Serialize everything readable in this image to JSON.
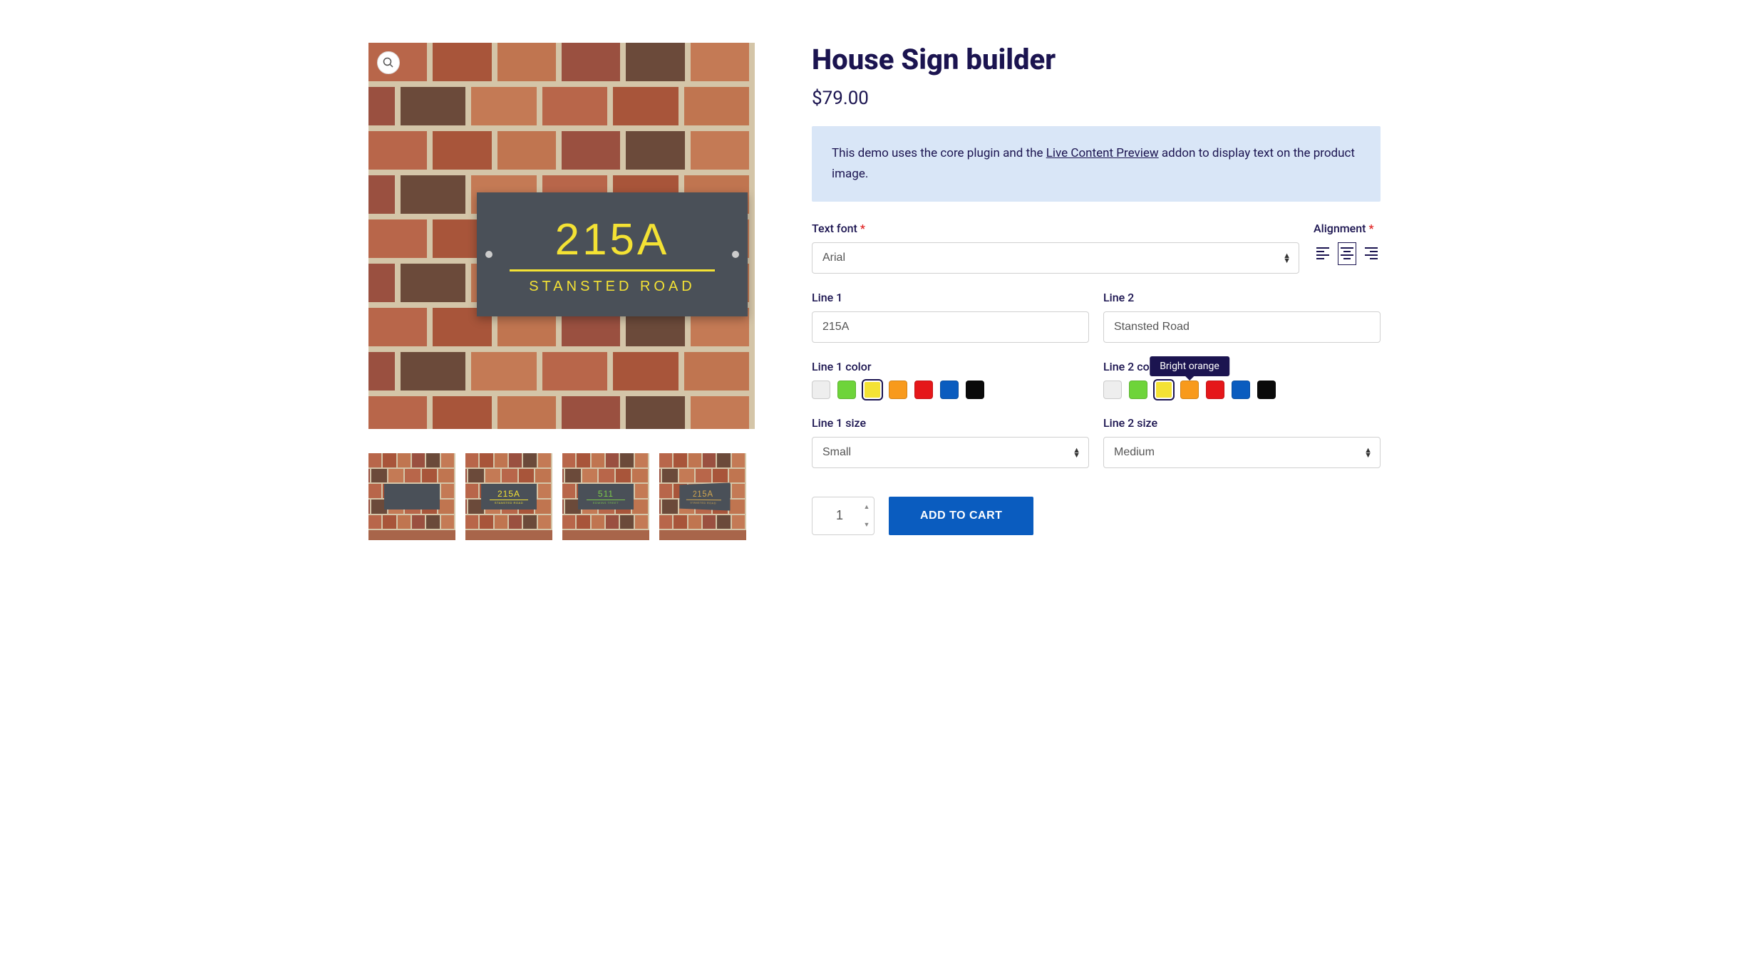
{
  "product": {
    "title": "House Sign builder",
    "price": "$79.00"
  },
  "notice": {
    "pre": "This demo uses the core plugin and the ",
    "link": "Live Content Preview",
    "post": " addon to display text on the product image."
  },
  "preview": {
    "line1": "215A",
    "line2": "STANSTED ROAD"
  },
  "thumbnails": [
    {
      "line1": "",
      "line2": "",
      "color": "#888"
    },
    {
      "line1": "215A",
      "line2": "STANSTED ROAD",
      "color": "#f4e234"
    },
    {
      "line1": "511",
      "line2": "EDWINS TREET",
      "color": "#7cc94a"
    },
    {
      "line1": "215A",
      "line2": "STANSTED ROAD",
      "color": "#d4a850"
    }
  ],
  "fields": {
    "font": {
      "label": "Text font",
      "value": "Arial"
    },
    "alignment": {
      "label": "Alignment",
      "value": "center"
    },
    "line1": {
      "label": "Line 1",
      "value": "215A"
    },
    "line2": {
      "label": "Line 2",
      "value": "Stansted Road"
    },
    "line1color": {
      "label": "Line 1 color",
      "selected": 2
    },
    "line2color": {
      "label": "Line 2 color",
      "selected": 2
    },
    "line1size": {
      "label": "Line 1 size",
      "value": "Small"
    },
    "line2size": {
      "label": "Line 2 size",
      "value": "Medium"
    }
  },
  "colors": [
    {
      "name": "White",
      "hex": "#eeeeee"
    },
    {
      "name": "Green",
      "hex": "#6ed43a"
    },
    {
      "name": "Yellow",
      "hex": "#f4e234"
    },
    {
      "name": "Bright orange",
      "hex": "#f89a1c"
    },
    {
      "name": "Red",
      "hex": "#e5171a"
    },
    {
      "name": "Blue",
      "hex": "#0a5cbf"
    },
    {
      "name": "Black",
      "hex": "#0a0a0a"
    }
  ],
  "tooltip": {
    "text": "Bright orange",
    "target": "line2color",
    "index": 3
  },
  "cart": {
    "qty": "1",
    "button": "ADD TO CART"
  }
}
